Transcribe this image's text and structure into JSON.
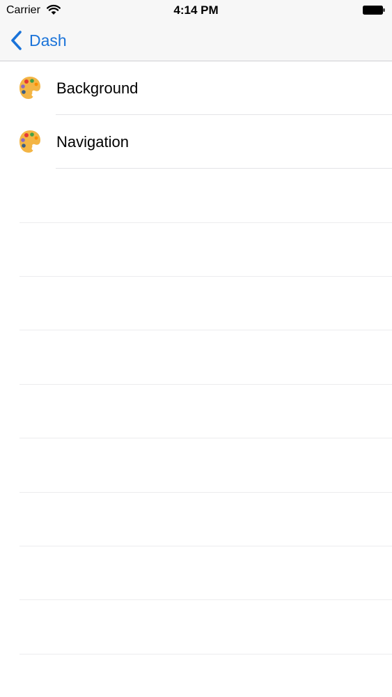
{
  "status_bar": {
    "carrier": "Carrier",
    "time": "4:14 PM",
    "wifi_icon": "wifi-icon",
    "battery_icon": "battery-full-icon"
  },
  "nav_bar": {
    "back_label": "Dash",
    "back_icon": "chevron-left-icon"
  },
  "colors": {
    "accent": "#1a73d9",
    "bar_background": "#f7f7f7",
    "separator": "#e3e3e6"
  },
  "list": {
    "items": [
      {
        "label": "Background",
        "icon": "palette-icon"
      },
      {
        "label": "Navigation",
        "icon": "palette-icon"
      }
    ]
  }
}
